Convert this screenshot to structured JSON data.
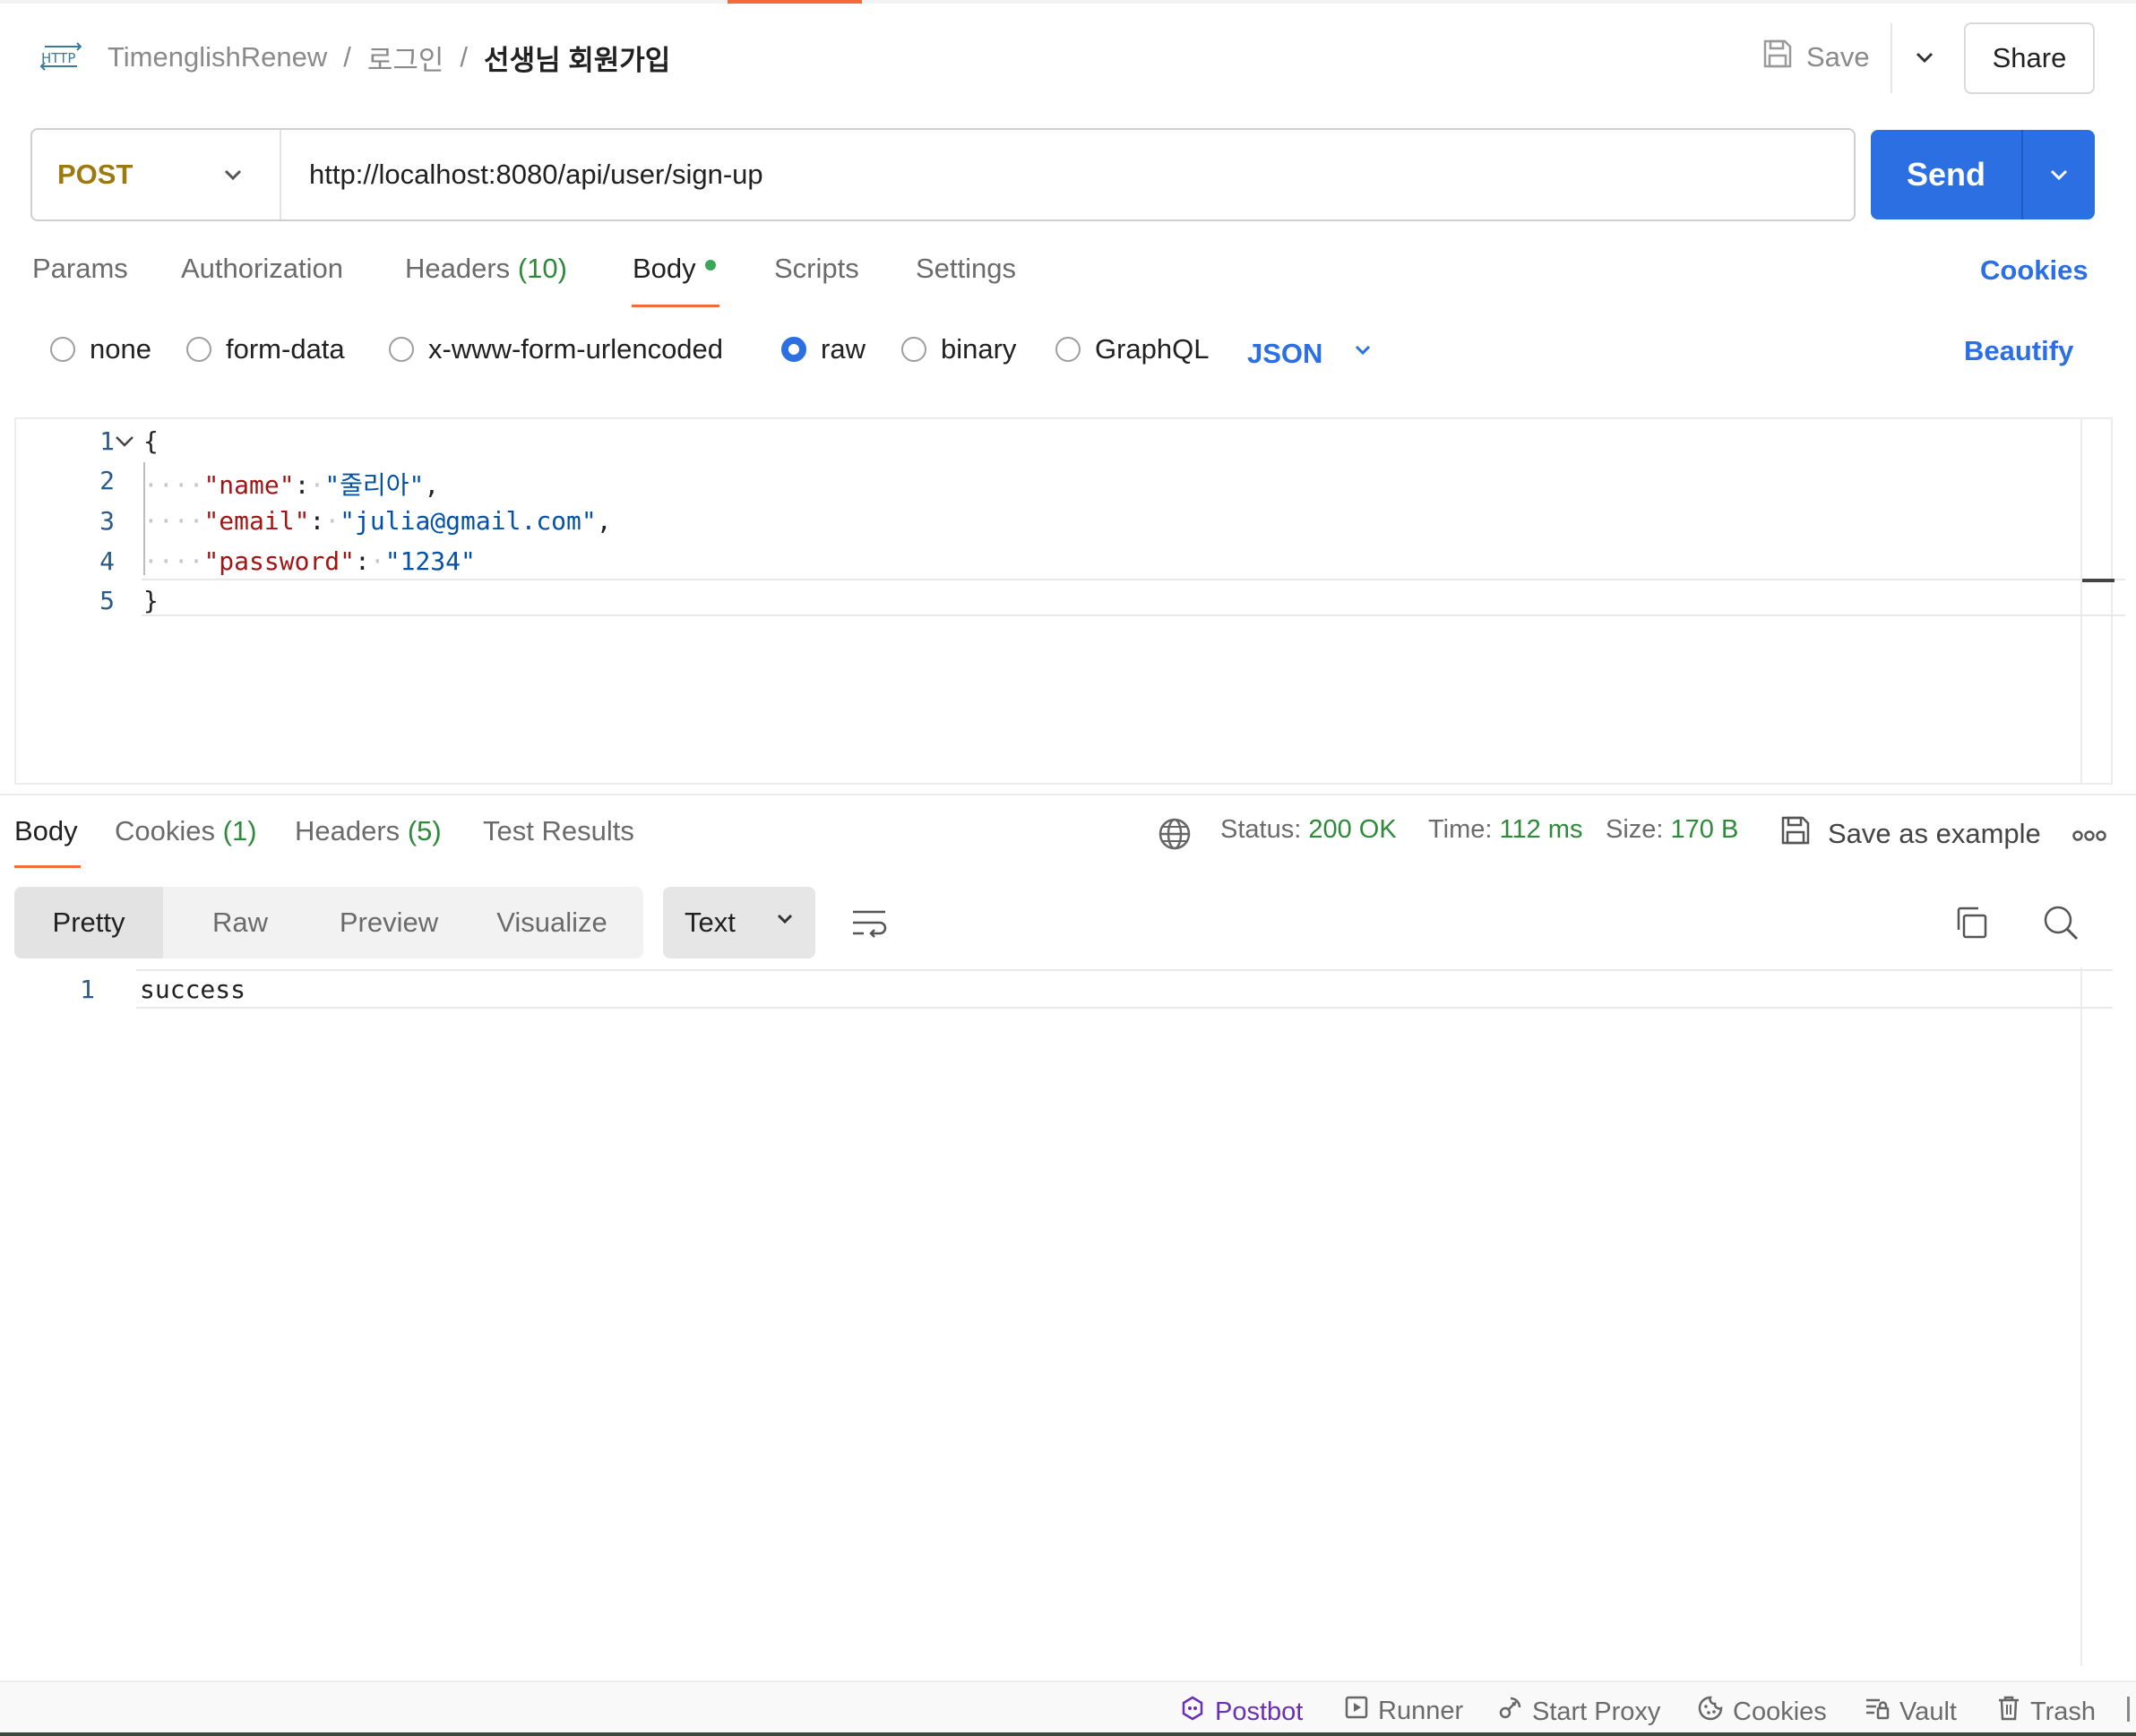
{
  "header": {
    "http_badge": "HTTP",
    "breadcrumb": [
      "TimenglishRenew",
      "로그인",
      "선생님 회원가입"
    ],
    "separator": "/",
    "save_label": "Save",
    "share_label": "Share"
  },
  "request": {
    "method": "POST",
    "url": "http://localhost:8080/api/user/sign-up",
    "send_label": "Send",
    "tabs": [
      {
        "label": "Params"
      },
      {
        "label": "Authorization"
      },
      {
        "label": "Headers",
        "count": "(10)"
      },
      {
        "label": "Body",
        "active": true
      },
      {
        "label": "Scripts"
      },
      {
        "label": "Settings"
      }
    ],
    "cookies_label": "Cookies",
    "body_types": [
      "none",
      "form-data",
      "x-www-form-urlencoded",
      "raw",
      "binary",
      "GraphQL"
    ],
    "selected_body_type": "raw",
    "format": "JSON",
    "beautify_label": "Beautify",
    "code_lines": [
      "1",
      "2",
      "3",
      "4",
      "5"
    ],
    "code": {
      "open": "{",
      "name_key": "\"name\"",
      "name_val": "\"줄리아\"",
      "email_key": "\"email\"",
      "email_val": "\"julia@gmail.com\"",
      "password_key": "\"password\"",
      "password_val": "\"1234\"",
      "close": "}"
    }
  },
  "response": {
    "tabs": [
      {
        "label": "Body",
        "active": true
      },
      {
        "label": "Cookies",
        "count": "(1)"
      },
      {
        "label": "Headers",
        "count": "(5)"
      },
      {
        "label": "Test Results"
      }
    ],
    "status_label": "Status:",
    "status_value": "200 OK",
    "time_label": "Time:",
    "time_value": "112 ms",
    "size_label": "Size:",
    "size_value": "170 B",
    "save_example_label": "Save as example",
    "views": [
      "Pretty",
      "Raw",
      "Preview",
      "Visualize"
    ],
    "active_view": "Pretty",
    "content_type": "Text",
    "line_no": "1",
    "body": "success"
  },
  "footer": {
    "items": [
      "Postbot",
      "Runner",
      "Start Proxy",
      "Cookies",
      "Vault",
      "Trash"
    ]
  },
  "colors": {
    "accent": "#f26b3a",
    "primary": "#2b6fe3",
    "method": "#9c7a10",
    "success": "#2e8a3a"
  }
}
